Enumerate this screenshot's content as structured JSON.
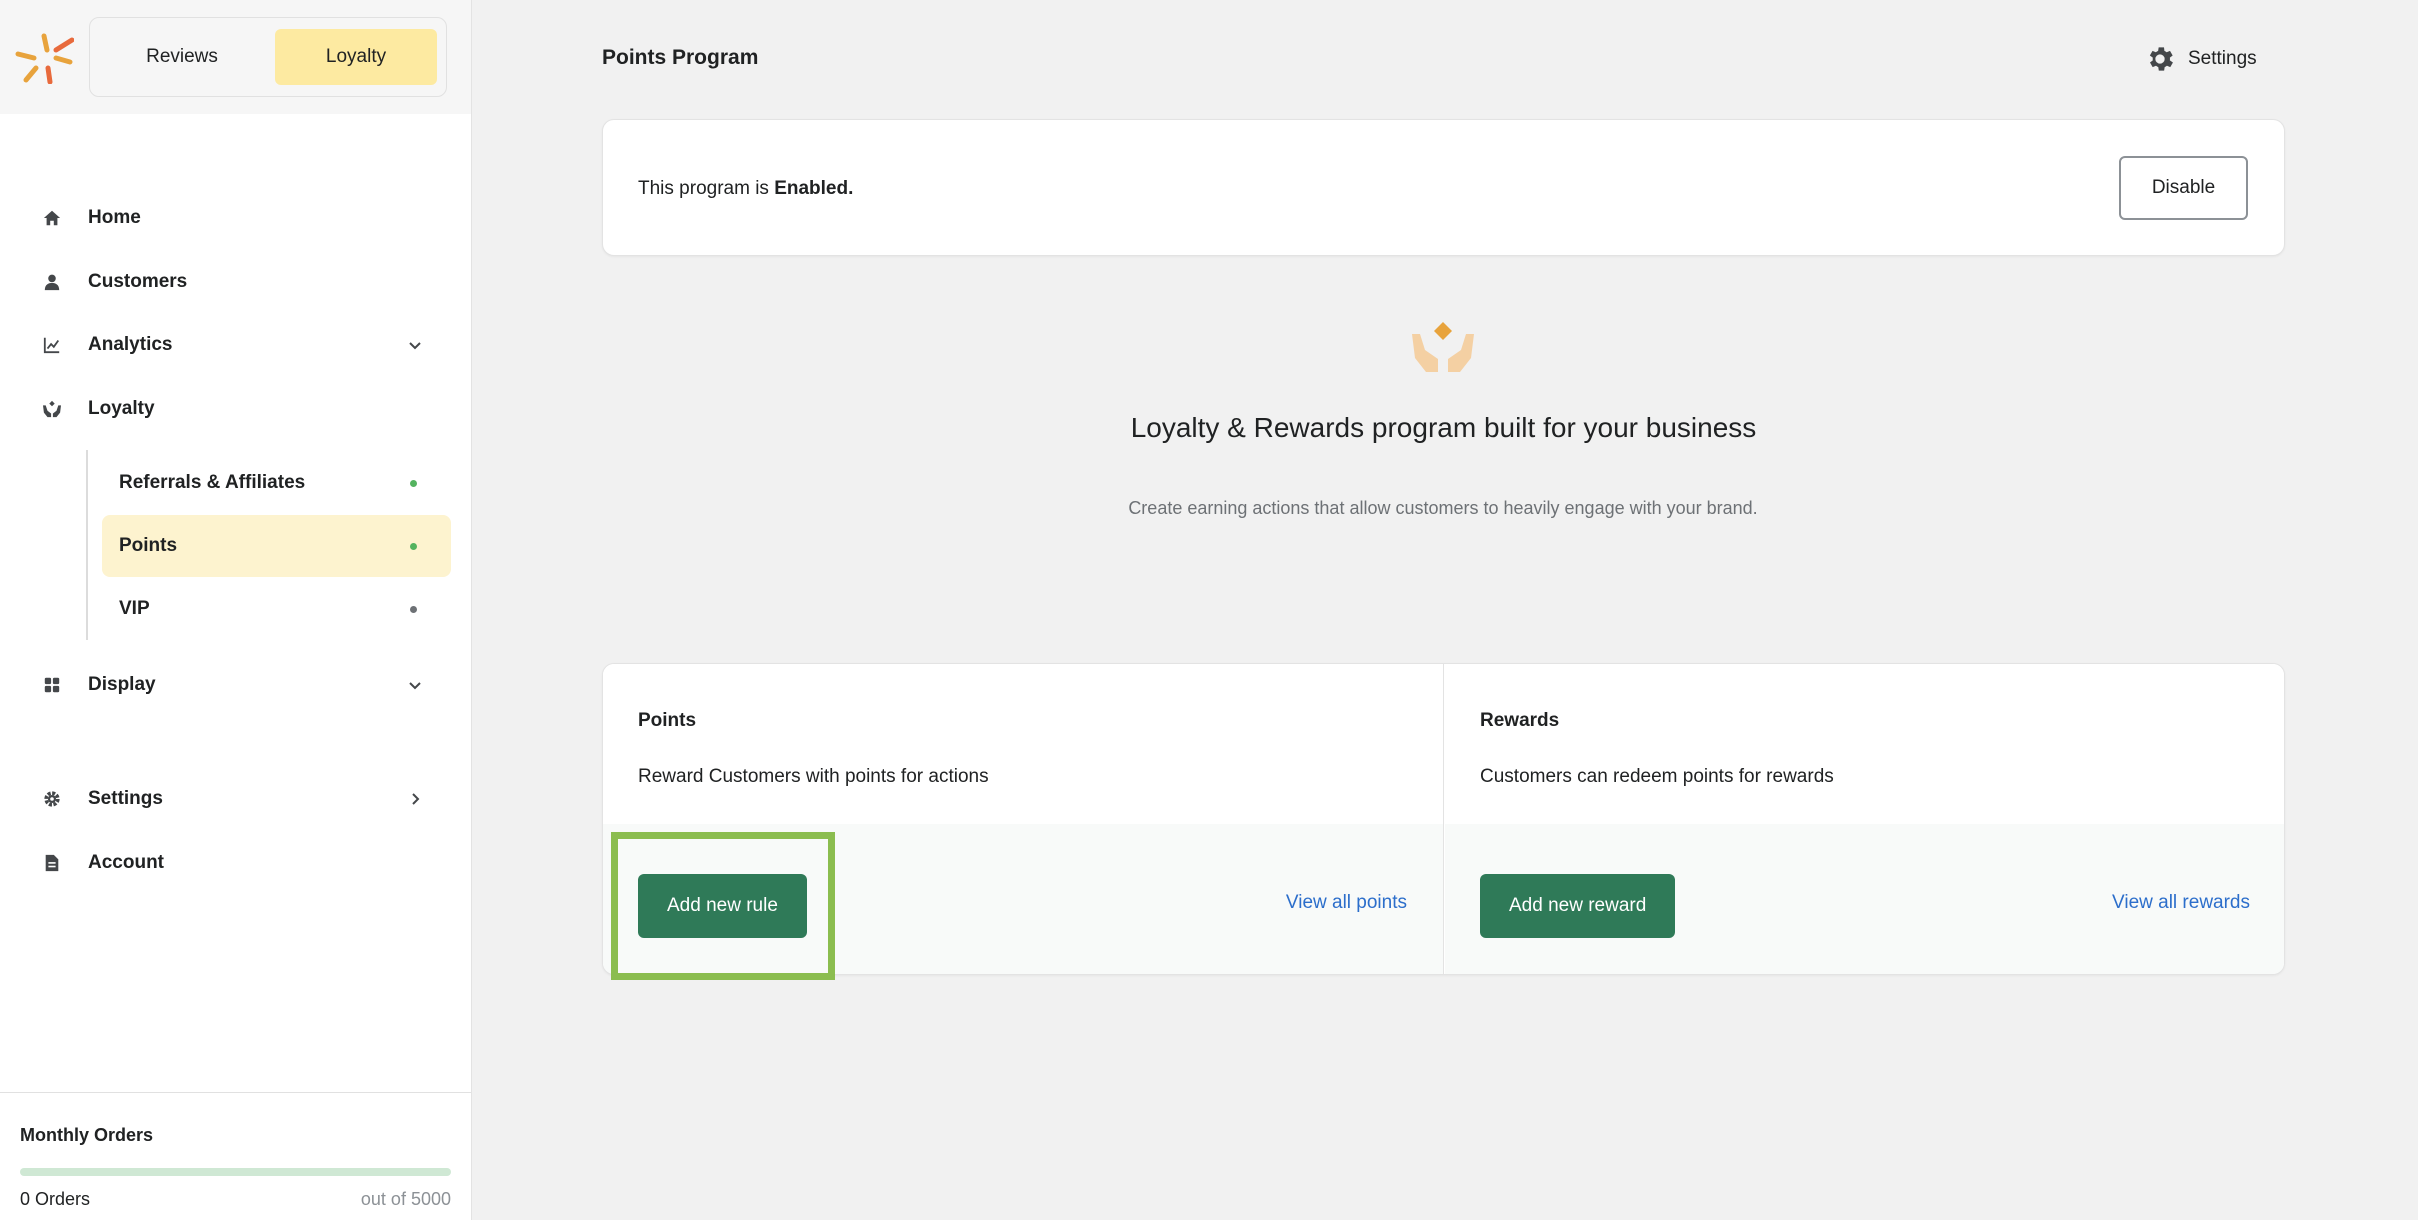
{
  "header": {
    "app_tabs": [
      {
        "label": "Reviews",
        "active": false
      },
      {
        "label": "Loyalty",
        "active": true
      }
    ]
  },
  "sidebar": {
    "items": [
      {
        "label": "Home",
        "icon": "home-icon"
      },
      {
        "label": "Customers",
        "icon": "person-icon"
      },
      {
        "label": "Analytics",
        "icon": "chart-icon",
        "chevron": "down"
      },
      {
        "label": "Loyalty",
        "icon": "loyalty-hands-icon"
      },
      {
        "label": "Display",
        "icon": "grid-icon",
        "chevron": "down"
      },
      {
        "label": "Settings",
        "icon": "gear-icon",
        "chevron": "right"
      },
      {
        "label": "Account",
        "icon": "document-icon"
      }
    ],
    "loyalty_sub_items": [
      {
        "label": "Referrals & Affiliates",
        "status_color": "#54b35f",
        "active": false
      },
      {
        "label": "Points",
        "status_color": "#54b35f",
        "active": true
      },
      {
        "label": "VIP",
        "status_color": "#6d7175",
        "active": false
      }
    ],
    "monthly_orders": {
      "title": "Monthly Orders",
      "count_label": "0 Orders",
      "max_label": "out of 5000",
      "progress_fraction": 0
    }
  },
  "main": {
    "page_title": "Points Program",
    "settings_label": "Settings",
    "status": {
      "prefix": "This program is",
      "state": "Enabled.",
      "button_label": "Disable"
    },
    "hero": {
      "title": "Loyalty & Rewards program built for your business",
      "description": "Create earning actions that allow customers to heavily engage with your brand."
    },
    "points": {
      "title": "Points",
      "description": "Reward Customers with points for actions",
      "button_label": "Add new rule",
      "link_label": "View all points"
    },
    "rewards": {
      "title": "Rewards",
      "description": "Customers can redeem points for rewards",
      "button_label": "Add new reward",
      "link_label": "View all rewards"
    }
  },
  "colors": {
    "accent_yellow": "#fdeaa1",
    "active_sub_bg": "#fdf3cf",
    "primary_green": "#2f7a58",
    "link_blue": "#2c6ecb",
    "highlight_green": "#8bbd4f",
    "brand_orange": "#e8a33c"
  }
}
